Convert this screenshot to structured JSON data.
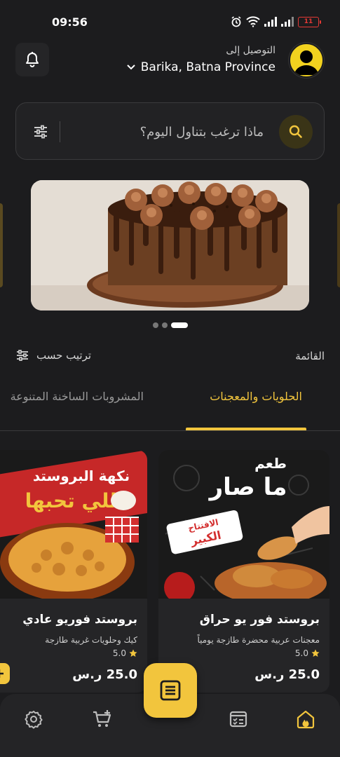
{
  "status_bar": {
    "time": "09:56",
    "battery": "11"
  },
  "header": {
    "delivery_label": "التوصيل إلى",
    "location": "Barika, Batna Province"
  },
  "search": {
    "placeholder": "ماذا ترغب بتناول اليوم؟"
  },
  "carousel": {
    "slide_count": 3,
    "active_index": 2
  },
  "menu": {
    "title": "القائمة",
    "sort_label": "ترتيب حسب"
  },
  "tabs": [
    {
      "label": "الحلويات والمعجنات",
      "active": true
    },
    {
      "label": "المشروبات الساخنة المتنوعة",
      "active": false
    }
  ],
  "products": [
    {
      "name": "بروستد فور يو حراق",
      "description": "معجنات عربية محضرة طازجة يومياً",
      "rating": "5.0",
      "price": "25.0 ر.س",
      "image_text": [
        "طعم",
        "ما صار",
        "الافتتاح",
        "الكبير"
      ]
    },
    {
      "name": "بروستد فوريو عادي",
      "description": "كيك وحلويات غربية طازجة",
      "rating": "5.0",
      "price": "25.0 ر.س",
      "image_text": [
        "نكهة البروستد",
        "اللي تحبها"
      ]
    }
  ],
  "bottom_nav": [
    {
      "name": "home",
      "icon": "home-icon",
      "active": true
    },
    {
      "name": "orders",
      "icon": "orders-icon",
      "active": false
    },
    {
      "name": "menu",
      "icon": "menu-icon",
      "active": false
    },
    {
      "name": "cart",
      "icon": "cart-icon",
      "active": false
    },
    {
      "name": "settings",
      "icon": "settings-icon",
      "active": false
    }
  ],
  "colors": {
    "accent": "#f2c53d",
    "background": "#1c1c1e",
    "surface": "#252527"
  }
}
